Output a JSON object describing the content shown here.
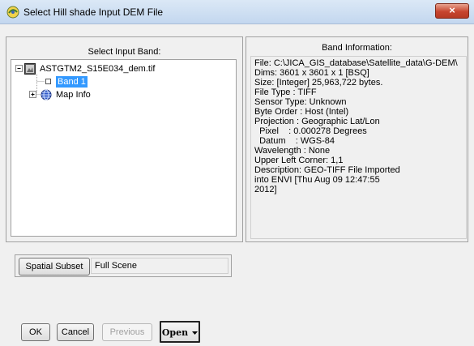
{
  "window": {
    "title": "Select Hill shade Input DEM File",
    "close_label": "×"
  },
  "left_panel": {
    "title": "Select Input Band:",
    "tree": {
      "file_name": "ASTGTM2_S15E034_dem.tif",
      "band_label": "Band 1",
      "map_info_label": "Map Info"
    }
  },
  "right_panel": {
    "title": "Band Information:",
    "lines": [
      "File: C:\\JICA_GIS_database\\Satellite_data\\G-DEM\\",
      "Dims: 3601 x 3601 x 1 [BSQ]",
      "Size: [Integer] 25,963,722 bytes.",
      "File Type  : TIFF",
      "Sensor Type: Unknown",
      "Byte Order : Host (Intel)",
      "Projection : Geographic Lat/Lon",
      "  Pixel    : 0.000278 Degrees",
      "  Datum    : WGS-84",
      "Wavelength : None",
      "Upper Left Corner: 1,1",
      "Description: GEO-TIFF File Imported",
      "into ENVI [Thu Aug 09 12:47:55",
      "2012]"
    ]
  },
  "subset": {
    "button_label": "Spatial Subset",
    "value": "Full Scene"
  },
  "buttons": {
    "ok": "OK",
    "cancel": "Cancel",
    "previous": "Previous",
    "open": "Open"
  }
}
